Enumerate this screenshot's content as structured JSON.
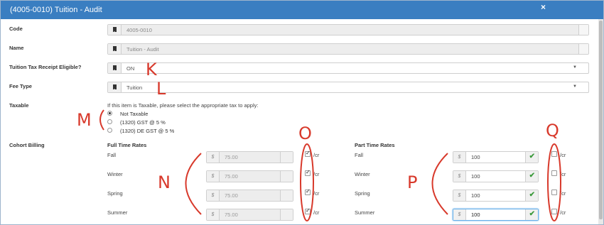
{
  "window": {
    "title": "(4005-0010) Tuition - Audit",
    "close_glyph": "×"
  },
  "form": {
    "code": {
      "label": "Code",
      "value": "4005-0010"
    },
    "name": {
      "label": "Name",
      "value": "Tuition - Audit"
    },
    "tax_receipt": {
      "label": "Tuition Tax Receipt Eligible?",
      "value": "ON"
    },
    "fee_type": {
      "label": "Fee Type",
      "value": "Tuition"
    },
    "taxable": {
      "label": "Taxable",
      "hint": "If this item is Taxable, please select the appropriate tax to apply:",
      "options": [
        "Not Taxable",
        "(1320) GST @ 5 %",
        "(1320) DE GST @ 5 %"
      ],
      "selected": 0
    },
    "cohort": {
      "label": "Cohort Billing",
      "full_time": {
        "heading": "Full Time Rates",
        "rows": [
          {
            "term": "Fall",
            "currency": "$",
            "amount": "75.00",
            "per_credit": true,
            "unit": "/cr"
          },
          {
            "term": "Winter",
            "currency": "$",
            "amount": "75.00",
            "per_credit": true,
            "unit": "/cr"
          },
          {
            "term": "Spring",
            "currency": "$",
            "amount": "75.00",
            "per_credit": true,
            "unit": "/cr"
          },
          {
            "term": "Summer",
            "currency": "$",
            "amount": "75.00",
            "per_credit": true,
            "unit": "/cr"
          }
        ]
      },
      "part_time": {
        "heading": "Part Time Rates",
        "rows": [
          {
            "term": "Fall",
            "currency": "$",
            "amount": "100",
            "per_credit": false,
            "unit": "/cr"
          },
          {
            "term": "Winter",
            "currency": "$",
            "amount": "100",
            "per_credit": false,
            "unit": "/cr"
          },
          {
            "term": "Spring",
            "currency": "$",
            "amount": "100",
            "per_credit": false,
            "unit": "/cr"
          },
          {
            "term": "Summer",
            "currency": "$",
            "amount": "100",
            "per_credit": false,
            "unit": "/cr"
          }
        ]
      }
    }
  },
  "annotations": {
    "k": "K",
    "l": "L",
    "m": "M",
    "n": "N",
    "o": "O",
    "p": "P",
    "q": "Q"
  },
  "colors": {
    "titlebar": "#3a7ec1",
    "annotation": "#d8392b",
    "valid": "#3c9a3c"
  }
}
